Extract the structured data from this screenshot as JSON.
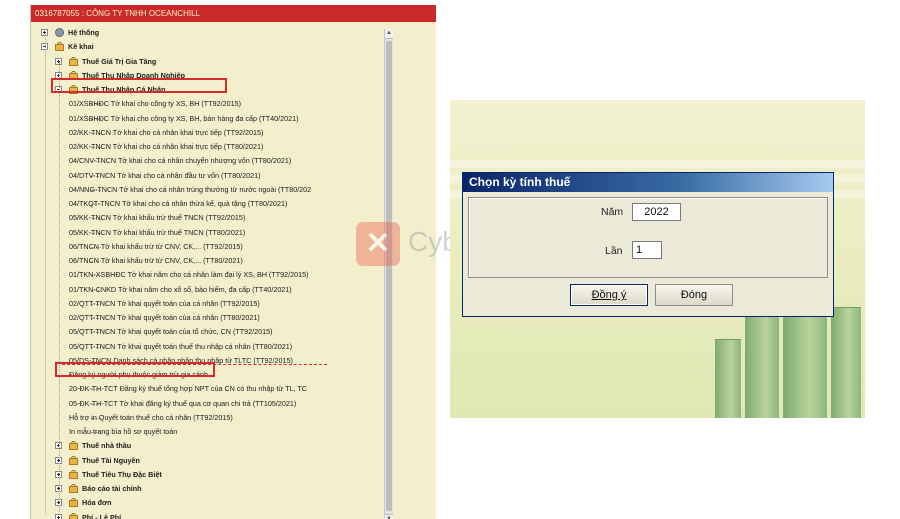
{
  "tree": {
    "window_title": "0316787055 : CÔNG TY TNHH OCEANCHILL",
    "nodes": [
      {
        "label": "Hệ thống",
        "bold": true
      },
      {
        "label": "Kê khai",
        "bold": true
      },
      {
        "label": "Thuế Giá Trị Gia Tăng",
        "bold": true
      },
      {
        "label": "Thuế Thu Nhập Doanh Nghiệp",
        "bold": true
      },
      {
        "label": "Thuế Thu Nhập Cá Nhân",
        "bold": true
      },
      {
        "label": "01/XSBHĐC Tờ khai cho công ty XS, BH (TT92/2015)"
      },
      {
        "label": "01/XSBHĐC Tờ khai cho công ty XS, BH, bán hàng đa cấp (TT40/2021)"
      },
      {
        "label": "02/KK-TNCN Tờ khai cho cá nhân khai trực tiếp (TT92/2015)"
      },
      {
        "label": "02/KK-TNCN Tờ khai cho cá nhân khai trực tiếp (TT80/2021)"
      },
      {
        "label": "04/CNV-TNCN Tờ khai cho cá nhân chuyển nhượng vốn (TT80/2021)"
      },
      {
        "label": "04/DTV-TNCN Tờ khai cho cá nhân đầu tư vốn (TT80/2021)"
      },
      {
        "label": "04/NNG-TNCN Tờ khai cho cá nhân trúng thưởng từ nước ngoài (TT80/202"
      },
      {
        "label": "04/TKQT-TNCN Tờ khai cho cá nhân thừa kế, quà tặng (TT80/2021)"
      },
      {
        "label": "05/KK-TNCN Tờ khai khấu trừ thuế TNCN (TT92/2015)"
      },
      {
        "label": "05/KK-TNCN Tờ khai khấu trừ thuế TNCN (TT80/2021)"
      },
      {
        "label": "06/TNCN Tờ khai khấu trừ từ CNV, CK,... (TT92/2015)"
      },
      {
        "label": "06/TNCN Tờ khai khấu trừ từ CNV, CK,... (TT80/2021)"
      },
      {
        "label": "01/TKN-XSBHĐC Tờ khai năm cho cá nhân làm đại lý XS, BH (TT92/2015)"
      },
      {
        "label": "01/TKN-CNKD Tờ khai năm cho xổ số, bảo hiểm, đa cấp (TT40/2021)"
      },
      {
        "label": "02/QTT-TNCN Tờ khai quyết toán của cá nhân (TT92/2015)"
      },
      {
        "label": "02/QTT-TNCN Tờ khai quyết toán của cá nhân (TT80/2021)"
      },
      {
        "label": "05/QTT-TNCN Tờ khai quyết toán của tổ chức, CN (TT92/2015)"
      },
      {
        "label": "05/QTT-TNCN Tờ khai quyết toán thuế thu nhập cá nhân (TT80/2021)"
      },
      {
        "label": "05/DS-TNCN Danh sách cá nhân nhận thu nhập từ TLTC (TT92/2015)"
      },
      {
        "label": "Đăng ký người phụ thuộc giảm trừ gia cảnh"
      },
      {
        "label": "20-ĐK-TH-TCT Đăng ký thuế tổng hợp NPT của CN có thu nhập từ TL, TC"
      },
      {
        "label": "05-ĐK-TH-TCT Tờ khai đăng ký thuế qua cơ quan chi trả (TT105/2021)"
      },
      {
        "label": "Hỗ trợ in Quyết toán thuế cho cá nhân (TT92/2015)"
      },
      {
        "label": "In mẫu trang bìa hồ sơ quyết toán"
      },
      {
        "label": "Thuế nhà thầu",
        "bold": true
      },
      {
        "label": "Thuế Tài Nguyên",
        "bold": true
      },
      {
        "label": "Thuế Tiêu Thụ Đặc Biệt",
        "bold": true
      },
      {
        "label": "Báo cáo tài chính",
        "bold": true
      },
      {
        "label": "Hóa đơn",
        "bold": true
      },
      {
        "label": "Phí - Lệ Phí",
        "bold": true
      }
    ]
  },
  "watermark": {
    "logo_glyph": "✕",
    "text": "Cyber"
  },
  "dialog": {
    "title": "Chọn kỳ tính thuế",
    "year_label": "Năm",
    "year_value": "2022",
    "times_label": "Lần",
    "times_value": "1",
    "ok_label": "Đồng ý",
    "close_label": "Đóng"
  },
  "icons": {
    "expand": "plus-box-icon",
    "collapse": "minus-box-icon",
    "folder": "locked-folder-icon",
    "system": "gear-icon"
  },
  "colors": {
    "title_bar_red": "#cc2a2a",
    "highlight_red": "#d42b2b",
    "tree_bg": "#f3eecc",
    "dialog_title_blue": "#0a246a"
  }
}
